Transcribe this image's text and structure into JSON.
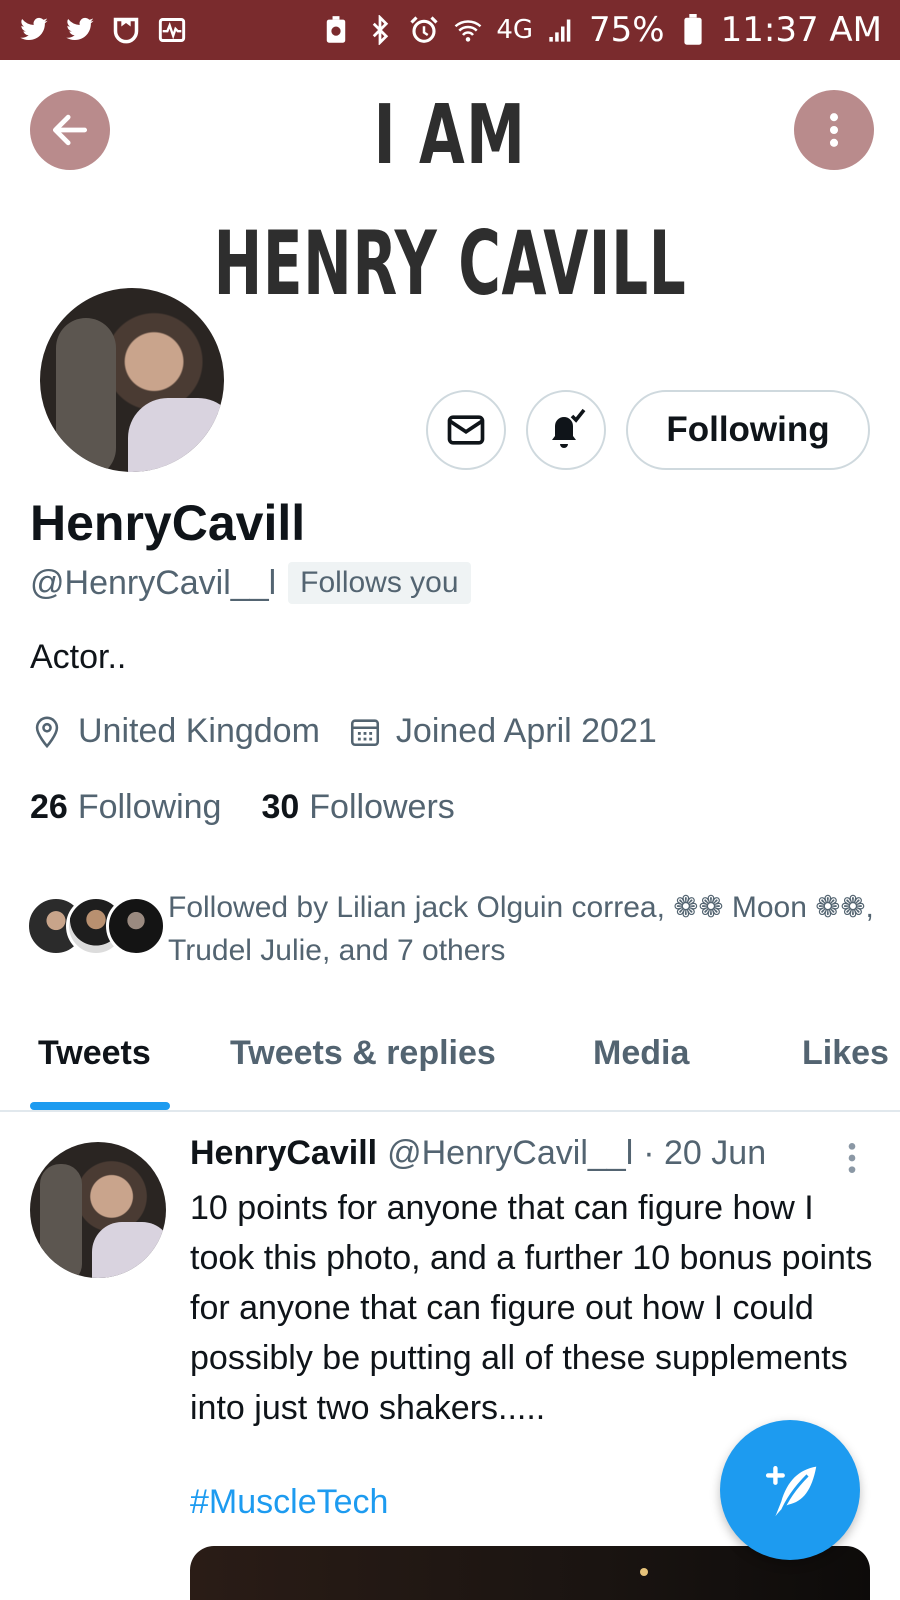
{
  "status_bar": {
    "left_icons": [
      "twitter-icon",
      "twitter-icon",
      "shield-icon",
      "activity-icon"
    ],
    "network": "4G",
    "battery": "75%",
    "time": "11:37 AM"
  },
  "banner": {
    "line1": "I AM",
    "line2": "HENRY CAVILL"
  },
  "profile": {
    "display_name": "HenryCavill",
    "handle": "@HenryCavil__l",
    "follows_you": "Follows you",
    "bio": "Actor..",
    "location": "United Kingdom",
    "joined": "Joined April 2021",
    "following_count": "26",
    "following_label": "Following",
    "followers_count": "30",
    "followers_label": "Followers",
    "followed_by": "Followed by Lilian jack Olguin correa, ❁❁ Moon ❁❁, Trudel Julie, and 7 others",
    "follow_button": "Following"
  },
  "tabs": [
    {
      "label": "Tweets",
      "active": true
    },
    {
      "label": "Tweets & replies",
      "active": false
    },
    {
      "label": "Media",
      "active": false
    },
    {
      "label": "Likes",
      "active": false
    }
  ],
  "tweet": {
    "name": "HenryCavill",
    "handle": "@HenryCavil__l",
    "date": "· 20 Jun",
    "text": "10 points for anyone that can figure how I took this photo, and a further 10 bonus points for anyone that can figure out how I could possibly be putting all of these supplements into just two shakers.....",
    "hashtag": "#MuscleTech"
  },
  "colors": {
    "status_bar": "#7a2b2d",
    "round_button": "#b98b8c",
    "accent": "#1d9bf0",
    "secondary_text": "#536471"
  }
}
